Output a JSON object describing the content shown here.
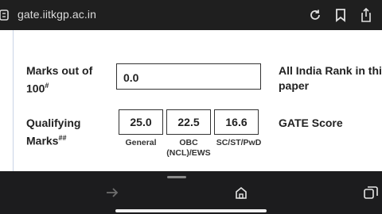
{
  "browser": {
    "url": "gate.iitkgp.ac.in"
  },
  "form": {
    "marks_label": "Marks out of",
    "marks_label_2": "100",
    "marks_sup": "#",
    "marks_value": "0.0",
    "rank_label_1": "All India Rank in this",
    "rank_label_2": "paper",
    "qualifying_label_1": "Qualifying",
    "qualifying_label_2": "Marks",
    "qualifying_sup": "##",
    "score_label": "GATE Score",
    "qualifying": [
      {
        "value": "25.0",
        "category": "General"
      },
      {
        "value": "22.5",
        "category": "OBC (NCL)/EWS"
      },
      {
        "value": "16.6",
        "category": "SC/ST/PwD"
      }
    ]
  }
}
